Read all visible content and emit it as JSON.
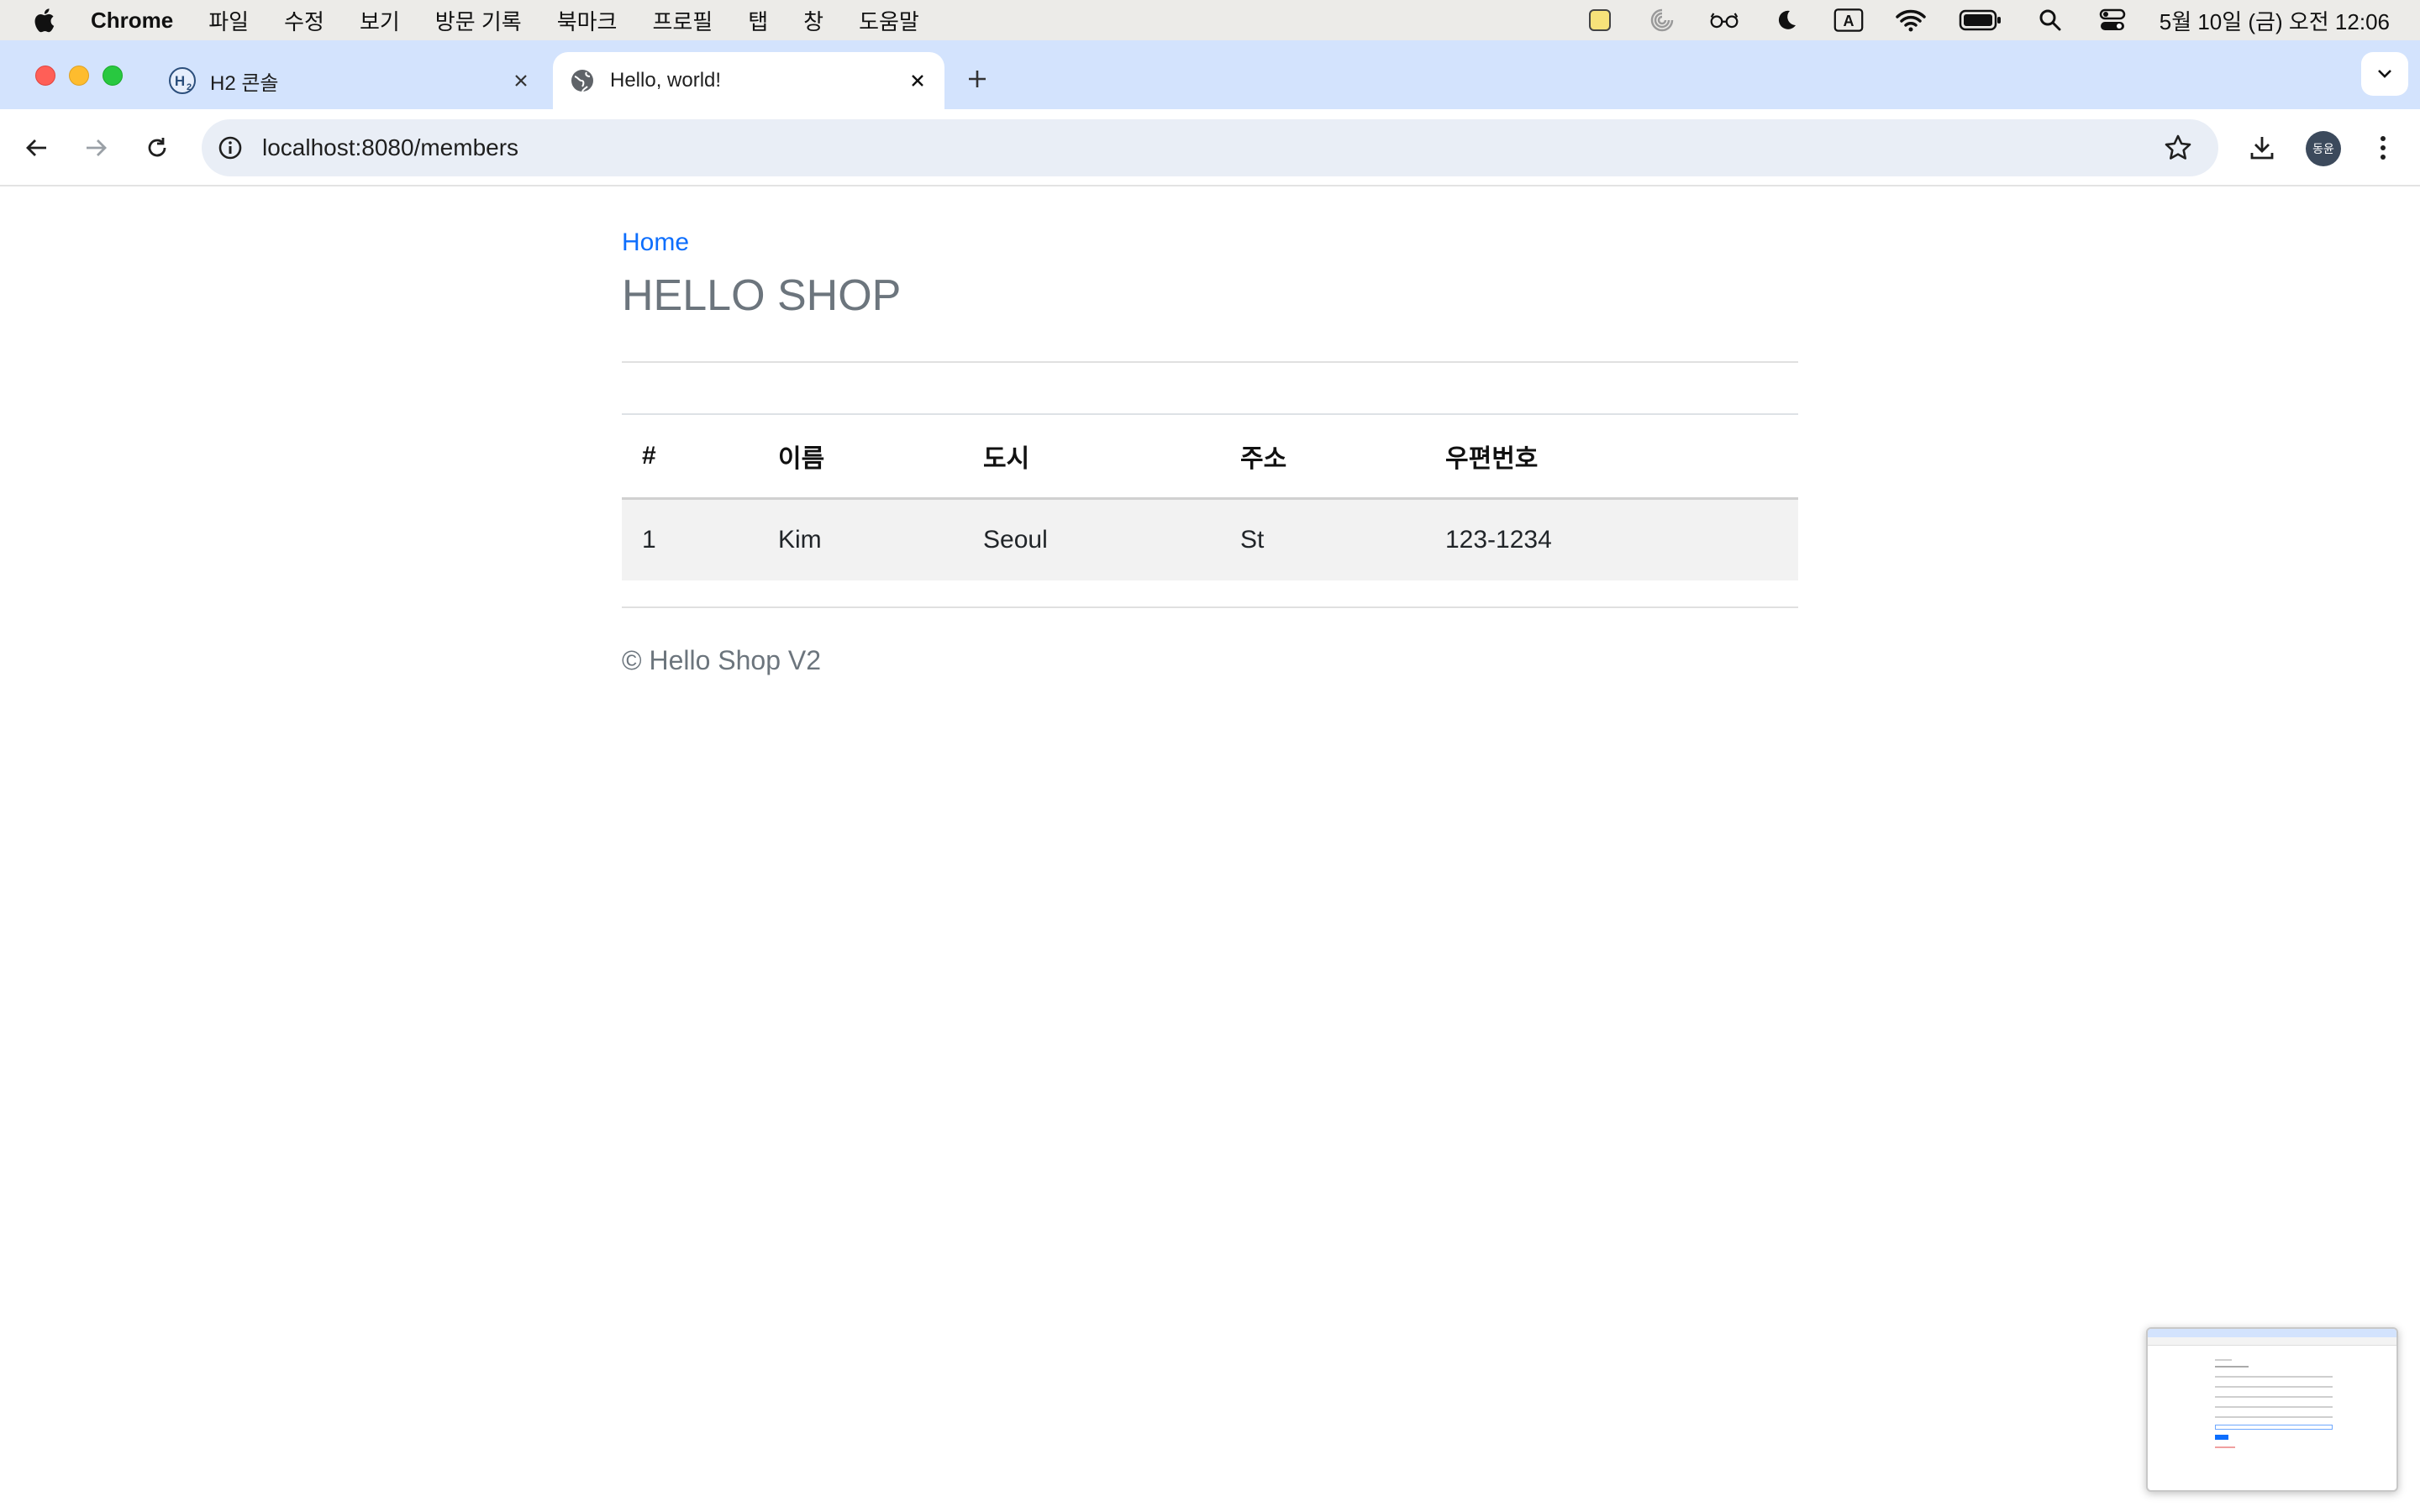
{
  "menubar": {
    "app_name": "Chrome",
    "items": [
      "파일",
      "수정",
      "보기",
      "방문 기록",
      "북마크",
      "프로필",
      "탭",
      "창",
      "도움말"
    ],
    "clock": "5월 10일 (금) 오전 12:06",
    "input_indicator": "A",
    "status_icons": [
      "notes-icon",
      "spiral-icon",
      "glasses-icon",
      "moon-icon",
      "input-source-icon",
      "wifi-icon",
      "battery-icon",
      "spotlight-search-icon",
      "control-center-icon"
    ]
  },
  "tabs": [
    {
      "title": "H2 콘솔",
      "favicon": "h2-icon",
      "active": false
    },
    {
      "title": "Hello, world!",
      "favicon": "globe-icon",
      "active": true
    }
  ],
  "toolbar": {
    "url": "localhost:8080/members",
    "profile_initials": "동윤"
  },
  "page": {
    "home_link": "Home",
    "title": "HELLO SHOP",
    "table": {
      "headers": [
        "#",
        "이름",
        "도시",
        "주소",
        "우편번호"
      ],
      "rows": [
        [
          "1",
          "Kim",
          "Seoul",
          "St",
          "123-1234"
        ]
      ]
    },
    "footer": "© Hello Shop V2"
  },
  "colors": {
    "link": "#0d6efd",
    "title": "#6c757d",
    "tab_strip": "#d3e3fd",
    "omnibox": "#e9eef6",
    "row_stripe": "#f2f2f2"
  }
}
